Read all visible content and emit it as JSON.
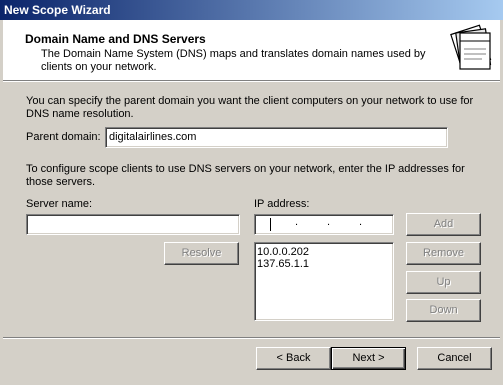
{
  "window": {
    "title": "New Scope Wizard"
  },
  "header": {
    "title": "Domain Name and DNS Servers",
    "description": "The Domain Name System (DNS) maps and translates domain names used by clients on your network.",
    "icon": "folders-icon"
  },
  "parent_domain": {
    "intro": "You can specify the parent domain you want the client computers on your network to use for DNS name resolution.",
    "label": "Parent domain:",
    "value": "digitalairlines.com"
  },
  "dns": {
    "intro": "To configure scope clients to use DNS servers on your network, enter the IP addresses for those servers.",
    "server_name_label": "Server name:",
    "server_name_value": "",
    "ip_label": "IP address:",
    "ip_value": "",
    "resolve_label": "Resolve",
    "add_label": "Add",
    "remove_label": "Remove",
    "up_label": "Up",
    "down_label": "Down",
    "servers": [
      "10.0.0.202",
      "137.65.1.1"
    ]
  },
  "footer": {
    "back_label": "< Back",
    "next_label": "Next >",
    "cancel_label": "Cancel"
  }
}
